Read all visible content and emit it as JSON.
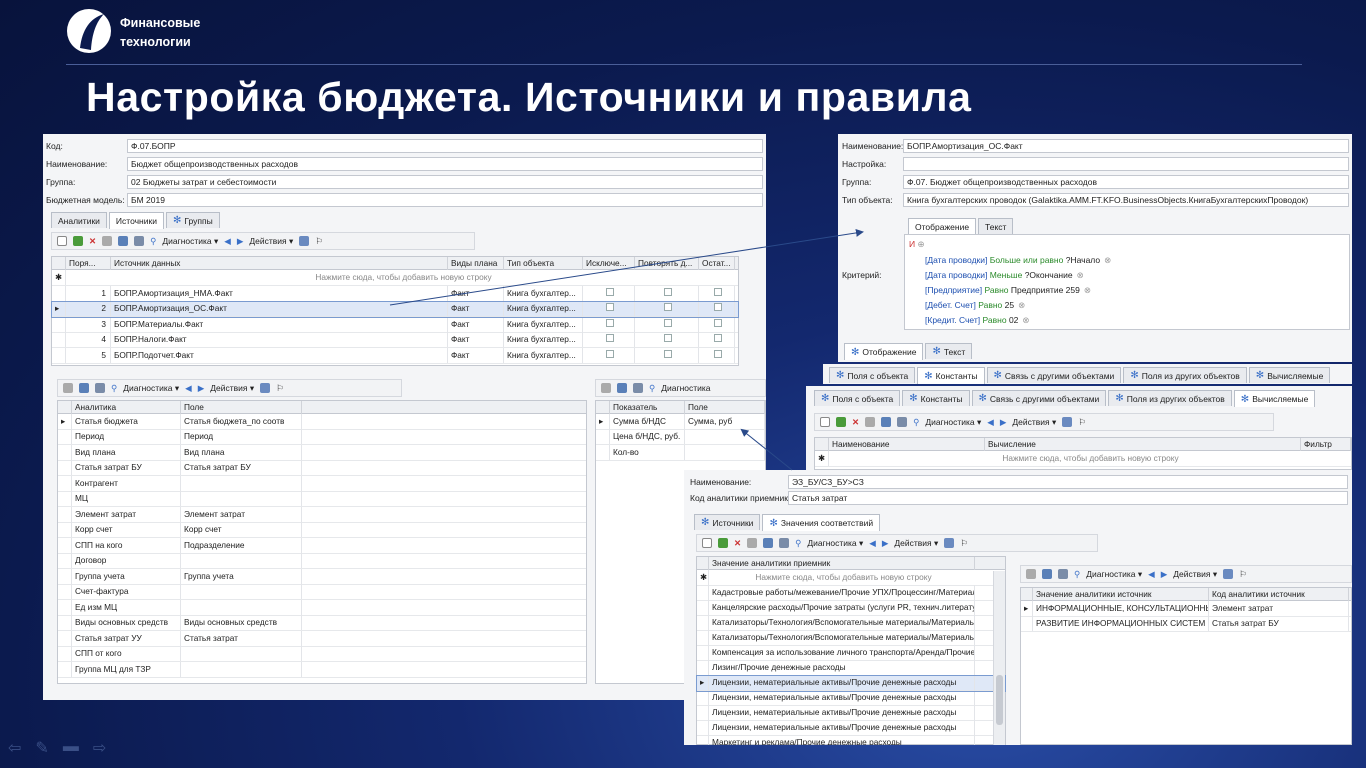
{
  "brand": {
    "line1": "Финансовые",
    "line2": "технологии"
  },
  "slide_title": "Настройка бюджета. Источники и правила",
  "w1": {
    "kod_label": "Код:",
    "kod": "Ф.07.БОПР",
    "name_label": "Наименование:",
    "name": "Бюджет общепроизводственных  расходов",
    "group_label": "Группа:",
    "group": "02 Бюджеты затрат и себестоимости",
    "model_label": "Бюджетная модель:",
    "model": "БМ 2019",
    "tabs": [
      "Аналитики",
      "Источники",
      "Группы"
    ],
    "toolbar": {
      "diag": "Диагностика",
      "actions": "Действия"
    },
    "cols": [
      "Поря...",
      "Источник данных",
      "Виды плана",
      "Тип объекта",
      "Исключе...",
      "Повторять д...",
      "Остат..."
    ],
    "hint": "Нажмите сюда, чтобы добавить новую строку",
    "rows": [
      {
        "n": "1",
        "src": "БОПР.Амортизация_НМА.Факт",
        "plan": "Факт",
        "type": "Книга бухгалтер..."
      },
      {
        "n": "2",
        "src": "БОПР.Амортизация_ОС.Факт",
        "plan": "Факт",
        "type": "Книга бухгалтер..."
      },
      {
        "n": "3",
        "src": "БОПР.Материалы.Факт",
        "plan": "Факт",
        "type": "Книга бухгалтер..."
      },
      {
        "n": "4",
        "src": "БОПР.Налоги.Факт",
        "plan": "Факт",
        "type": "Книга бухгалтер..."
      },
      {
        "n": "5",
        "src": "БОПР.Подотчет.Факт",
        "plan": "Факт",
        "type": "Книга бухгалтер..."
      }
    ],
    "an_cols": [
      "Аналитика",
      "Поле"
    ],
    "an_rows": [
      [
        "Статья бюджета",
        "Статья бюджета_по соотв"
      ],
      [
        "Период",
        "Период"
      ],
      [
        "Вид плана",
        "Вид плана"
      ],
      [
        "Статья затрат БУ",
        "Статья затрат БУ"
      ],
      [
        "Контрагент",
        ""
      ],
      [
        "МЦ",
        ""
      ],
      [
        "Элемент затрат",
        "Элемент затрат"
      ],
      [
        "Корр счет",
        "Корр счет"
      ],
      [
        "СПП на кого",
        "Подразделение"
      ],
      [
        "Договор",
        ""
      ],
      [
        "Группа учета",
        "Группа учета"
      ],
      [
        "Счет-фактура",
        ""
      ],
      [
        "Ед изм МЦ",
        ""
      ],
      [
        "Виды основных средств",
        "Виды основных средств"
      ],
      [
        "Статья затрат УУ",
        "Статья затрат"
      ],
      [
        "СПП от кого",
        ""
      ],
      [
        "Группа МЦ для ТЗР",
        ""
      ]
    ],
    "p_cols": [
      "Показатель",
      "Поле"
    ],
    "p_rows": [
      [
        "Сумма б/НДС",
        "Сумма, руб"
      ],
      [
        "Цена б/НДС, руб.",
        ""
      ],
      [
        "Кол-во",
        ""
      ]
    ]
  },
  "w2": {
    "name_label": "Наименование:",
    "name": "БОПР.Амортизация_ОС.Факт",
    "setup_label": "Настройка:",
    "setup": "",
    "group_label": "Группа:",
    "group": "Ф.07. Бюджет общепроизводственных расходов",
    "type_label": "Тип объекта:",
    "type": "Книга бухгалтерских проводок (Galaktika.AMM.FT.KFO.BusinessObjects.КнигаБухгалтерскихПроводок)",
    "tabs": [
      "Отображение",
      "Текст"
    ],
    "crit_label": "Критерий:",
    "and": "И",
    "crit": [
      {
        "f": "[Дата проводки]",
        "op": "Больше или равно",
        "v": "?Начало"
      },
      {
        "f": "[Дата проводки]",
        "op": "Меньше",
        "v": "?Окончание"
      },
      {
        "f": "[Предприятие]",
        "op": "Равно",
        "v": "Предприятие 259"
      },
      {
        "f": "[Дебет. Счет]",
        "op": "Равно",
        "v": "25"
      },
      {
        "f": "[Кредит. Счет]",
        "op": "Равно",
        "v": "02"
      }
    ],
    "btabs": [
      "Поля с объекта",
      "Константы",
      "Связь с другими объектами",
      "Поля из других объектов",
      "Вычисляемые"
    ]
  },
  "w3": {
    "tabs": [
      "Поля с объекта",
      "Константы",
      "Связь с другими объектами",
      "Поля из других объектов",
      "Вычисляемые"
    ]
  },
  "w4": {
    "tabs": [
      "Поля с объекта",
      "Константы",
      "Связь с другими объектами",
      "Поля из других объектов",
      "Вычисляемые"
    ],
    "toolbar": {
      "diag": "Диагностика",
      "actions": "Действия"
    },
    "cols": [
      "Наименование",
      "Вычисление",
      "Фильтр"
    ],
    "hint": "Нажмите сюда, чтобы добавить новую строку"
  },
  "w5": {
    "name_label": "Наименование:",
    "name": "ЭЗ_БУ/СЗ_БУ>СЗ",
    "code_label": "Код аналитики приемник:",
    "code": "Статья затрат",
    "tabs": [
      "Источники",
      "Значения соответствий"
    ],
    "toolbar": {
      "diag": "Диагностика",
      "actions": "Действия"
    },
    "col": "Значение аналитики приемник",
    "hint": "Нажмите сюда, чтобы добавить новую строку",
    "rows": [
      "Кадастровые работы/межевание/Прочие УПХ/Процессинг/Материаль...",
      "Канцелярские расходы/Прочие затраты (услуги PR, технич.литерату...",
      "Катализаторы/Технология/Вспомогательные материалы/Материальн...",
      "Катализаторы/Технология/Вспомогательные материалы/Материальн...",
      "Компенсация за использование личного транспорта/Аренда/Прочие д...",
      "Лизинг/Прочие денежные расходы",
      "Лицензии, нематериальные активы/Прочие денежные расходы",
      "Лицензии, нематериальные активы/Прочие денежные расходы",
      "Лицензии, нематериальные активы/Прочие денежные расходы",
      "Лицензии, нематериальные активы/Прочие денежные расходы",
      "Маркетинг и реклама/Прочие денежные расходы"
    ],
    "r_cols": [
      "Значение аналитики источник",
      "Код аналитики источник"
    ],
    "r_rows": [
      [
        "ИНФОРМАЦИОННЫЕ, КОНСУЛЬТАЦИОННЫЕ У...",
        "Элемент затрат"
      ],
      [
        "РАЗВИТИЕ ИНФОРМАЦИОННЫХ СИСТЕМ",
        "Статья затрат БУ"
      ]
    ]
  }
}
